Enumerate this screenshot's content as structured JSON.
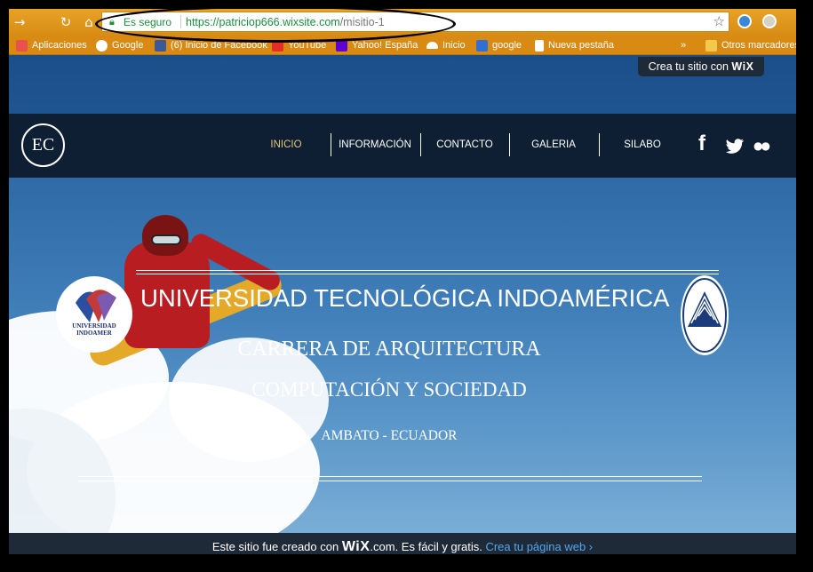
{
  "browser": {
    "secure_label": "Es seguro",
    "url_host": "https://patriciop666.wixsite.com",
    "url_path": "/misitio-1",
    "bookmarks": [
      {
        "label": "Aplicaciones",
        "icon": "apps-grid-icon",
        "color": "#e9524a"
      },
      {
        "label": "Google",
        "icon": "google-icon",
        "color": "#ffffff"
      },
      {
        "label": "(6) Inicio de Facebook",
        "icon": "facebook-icon",
        "color": "#3b5998"
      },
      {
        "label": "YouTube",
        "icon": "youtube-icon",
        "color": "#e52d27"
      },
      {
        "label": "Yahoo! España",
        "icon": "yahoo-icon",
        "color": "#5f01d1"
      },
      {
        "label": "Inicio",
        "icon": "cloud-icon",
        "color": "#ffffff"
      },
      {
        "label": "google",
        "icon": "b1-icon",
        "color": "#2f6fd6"
      },
      {
        "label": "Nueva pestaña",
        "icon": "page-icon",
        "color": "#ffffff"
      }
    ],
    "more_label": "»",
    "other_bookmarks": "Otros marcadores"
  },
  "wix_badge": {
    "prefix": "Crea tu sitio con",
    "brand": "WiX"
  },
  "site": {
    "logo": "EC",
    "nav": [
      "INICIO",
      "INFORMACIÓN",
      "CONTACTO",
      "GALERIA",
      "SILABO"
    ],
    "social_facebook": "f",
    "social_flickr": "●●"
  },
  "hero": {
    "title": "UNIVERSIDAD TECNOLÓGICA INDOAMÉRICA",
    "subtitle1": "CARRERA DE ARQUITECTURA",
    "subtitle2": "COMPUTACIÓN Y SOCIEDAD",
    "city": "AMBATO - ECUADOR",
    "seal_left_text": "UNIVERSIDAD INDOAMER"
  },
  "footer": {
    "prefix": "Este sitio fue creado con",
    "brand": "WiX",
    "suffix": ".com. Es fácil y gratis.",
    "link": "Crea tu página web ›"
  },
  "colors": {
    "toolbar": "#e09a1f",
    "nav_bg": "#0e1f33",
    "nav_active": "#e6c67a",
    "footer_link": "#53a6ee",
    "secure_green": "#1e8e3e"
  }
}
